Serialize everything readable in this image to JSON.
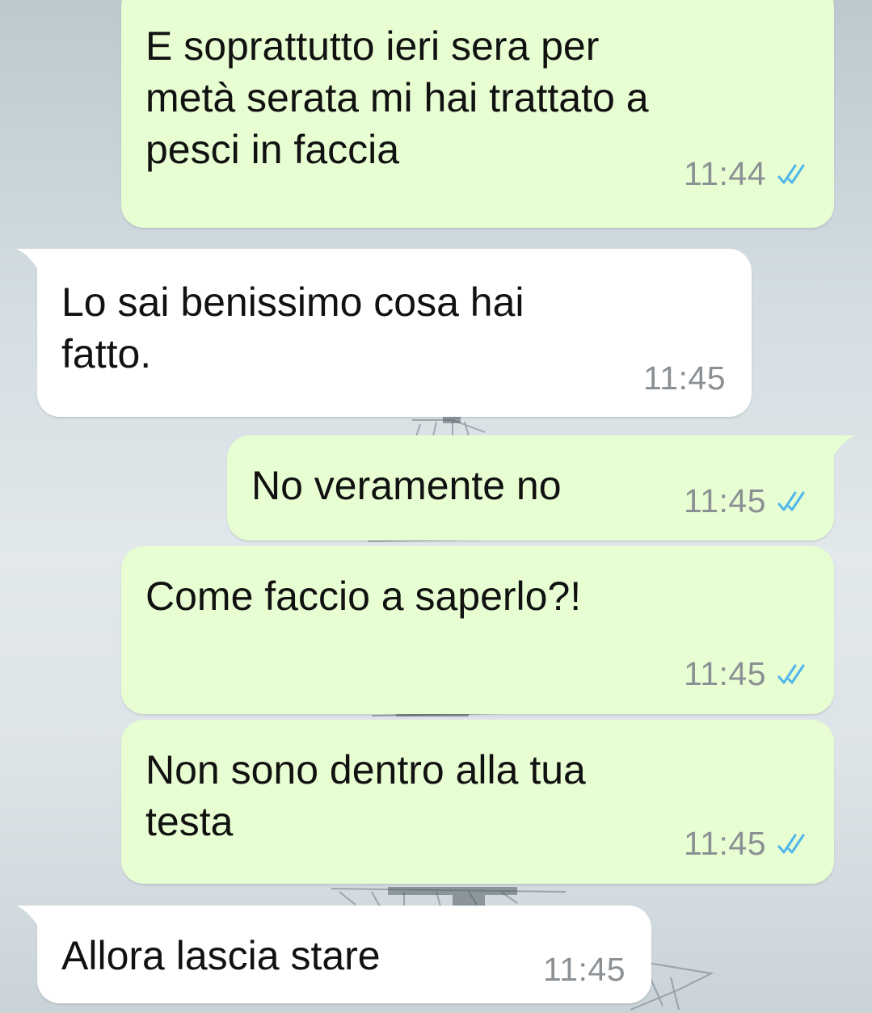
{
  "chat": {
    "colors": {
      "outgoing_bubble": "#e7fdd2",
      "incoming_bubble": "#ffffff",
      "read_ticks": "#4fb6ec",
      "timestamp": "#8b9094"
    },
    "messages": [
      {
        "direction": "outgoing",
        "text": "E soprattutto ieri sera per\nmetà serata mi hai trattato a\npesci in faccia",
        "time": "11:44",
        "status": "read-double-check-icon"
      },
      {
        "direction": "incoming",
        "text": "Lo sai benissimo cosa hai\nfatto.",
        "time": "11:45"
      },
      {
        "direction": "outgoing",
        "text": "No veramente no",
        "time": "11:45",
        "status": "read-double-check-icon"
      },
      {
        "direction": "outgoing",
        "text": "Come faccio a saperlo?!",
        "time": "11:45",
        "status": "read-double-check-icon"
      },
      {
        "direction": "outgoing",
        "text": "Non sono dentro alla tua\ntesta",
        "time": "11:45",
        "status": "read-double-check-icon"
      },
      {
        "direction": "incoming",
        "text": "Allora lascia stare",
        "time": "11:45"
      }
    ]
  }
}
